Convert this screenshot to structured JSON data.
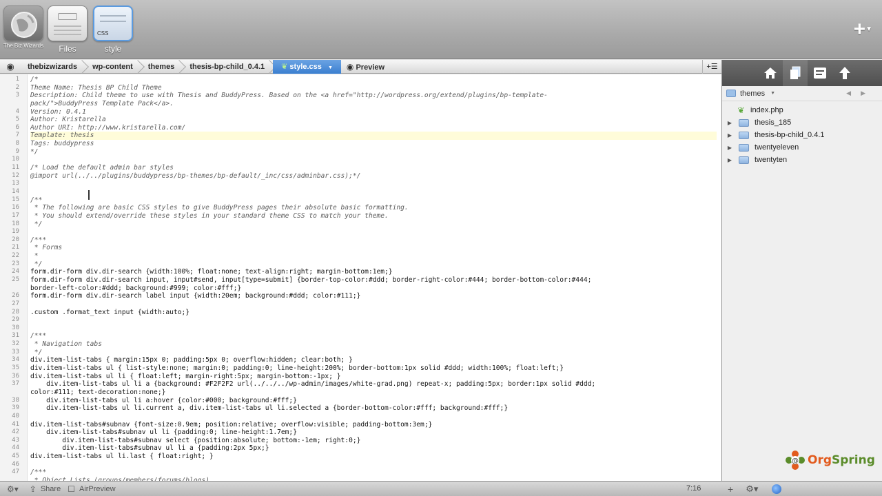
{
  "projects": [
    {
      "label": "The Biz Wizards"
    },
    {
      "label": "Files"
    },
    {
      "label": "style",
      "thumb_tag": "CSS"
    }
  ],
  "breadcrumb": {
    "items": [
      "thebizwizards",
      "wp-content",
      "themes",
      "thesis-bp-child_0.4.1"
    ],
    "active": "style.css",
    "preview": "Preview"
  },
  "editor": {
    "line_numbers": [
      "1",
      "2",
      "3",
      "4",
      "5",
      "6",
      "7",
      "8",
      "9",
      "10",
      "11",
      "12",
      "13",
      "14",
      "15",
      "16",
      "17",
      "18",
      "19",
      "20",
      "21",
      "22",
      "23",
      "24",
      "25",
      "26",
      "27",
      "28",
      "29",
      "30",
      "31",
      "32",
      "33",
      "34",
      "35",
      "36",
      "37",
      "38",
      "39",
      "40",
      "41",
      "42",
      "43",
      "44",
      "45",
      "46",
      "47"
    ],
    "lines": [
      "/*",
      "Theme Name: Thesis BP Child Theme",
      "Description: Child theme to use with Thesis and BuddyPress. Based on the <a href=\"http://wordpress.org/extend/plugins/bp-template-",
      "pack/\">BuddyPress Template Pack</a>.",
      "Version: 0.4.1",
      "Author: Kristarella",
      "Author URI: http://www.kristarella.com/",
      "Template: thesis",
      "Tags: buddypress",
      "*/",
      "",
      "/* Load the default admin bar styles",
      "@import url(../../plugins/buddypress/bp-themes/bp-default/_inc/css/adminbar.css);*/",
      "",
      "",
      "/**",
      " * The following are basic CSS styles to give BuddyPress pages their absolute basic formatting.",
      " * You should extend/override these styles in your standard theme CSS to match your theme.",
      " */",
      "",
      "/***",
      " * Forms",
      " *",
      " */",
      "form.dir-form div.dir-search {width:100%; float:none; text-align:right; margin-bottom:1em;}",
      "form.dir-form div.dir-search input, input#send, input[type=submit] {border-top-color:#ddd; border-right-color:#444; border-bottom-color:#444;",
      "border-left-color:#ddd; background:#999; color:#fff;}",
      "form.dir-form div.dir-search label input {width:20em; background:#ddd; color:#111;}",
      "",
      ".custom .format_text input {width:auto;}",
      "",
      "",
      "/***",
      " * Navigation tabs",
      " */",
      "div.item-list-tabs { margin:15px 0; padding:5px 0; overflow:hidden; clear:both; }",
      "div.item-list-tabs ul { list-style:none; margin:0; padding:0; line-height:200%; border-bottom:1px solid #ddd; width:100%; float:left;}",
      "div.item-list-tabs ul li { float:left; margin-right:5px; margin-bottom:-1px; }",
      "    div.item-list-tabs ul li a {background: #F2F2F2 url(../../../wp-admin/images/white-grad.png) repeat-x; padding:5px; border:1px solid #ddd;",
      "color:#111; text-decoration:none;}",
      "    div.item-list-tabs ul li a:hover {color:#000; background:#fff;}",
      "    div.item-list-tabs ul li.current a, div.item-list-tabs ul li.selected a {border-bottom-color:#fff; background:#fff;}",
      "",
      "div.item-list-tabs#subnav {font-size:0.9em; position:relative; overflow:visible; padding-bottom:3em;}",
      "    div.item-list-tabs#subnav ul li {padding:0; line-height:1.7em;}",
      "        div.item-list-tabs#subnav select {position:absolute; bottom:-1em; right:0;}",
      "        div.item-list-tabs#subnav ul li a {padding:2px 5px;}",
      "div.item-list-tabs ul li.last { float:right; }",
      "",
      "/***",
      " * Object Lists (groups/members/forums/blogs)"
    ]
  },
  "status_bar": {
    "share": "Share",
    "airpreview": "AirPreview",
    "time": "7:16"
  },
  "right_panel": {
    "folder": "themes",
    "tree": [
      {
        "name": "index.php",
        "type": "file"
      },
      {
        "name": "thesis_185",
        "type": "folder"
      },
      {
        "name": "thesis-bp-child_0.4.1",
        "type": "folder"
      },
      {
        "name": "twentyeleven",
        "type": "folder"
      },
      {
        "name": "twentyten",
        "type": "folder"
      }
    ]
  },
  "watermark": {
    "prefix": "Org",
    "suffix": "Spring"
  },
  "colors": {
    "accent": "#3b7fd0",
    "leaf": "#5aa83a",
    "logo_orange": "#e25b1e",
    "logo_green": "#5b8c2a"
  }
}
